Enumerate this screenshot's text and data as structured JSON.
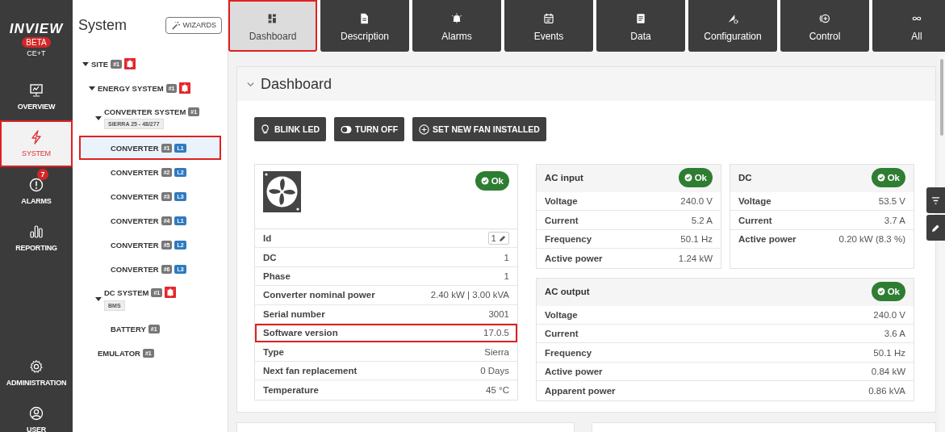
{
  "nav": {
    "logo": "INVIEW",
    "beta": "BETA",
    "subtitle": "CE+T",
    "items": [
      {
        "label": "OVERVIEW",
        "selected": false,
        "highlighted": false
      },
      {
        "label": "SYSTEM",
        "selected": true,
        "highlighted": true
      },
      {
        "label": "ALARMS",
        "selected": false,
        "highlighted": false,
        "badge": "7"
      },
      {
        "label": "REPORTING",
        "selected": false,
        "highlighted": false
      }
    ],
    "bottom_items": [
      {
        "label": "ADMINISTRATION",
        "selected": false,
        "highlighted": false
      },
      {
        "label": "USER",
        "selected": false,
        "highlighted": false
      }
    ]
  },
  "tree": {
    "title": "System",
    "wizards_button": "WIZARDS",
    "nodes": [
      {
        "label": "SITE",
        "tag": "#1",
        "alarm": true,
        "expanded": true,
        "selected": false,
        "highlighted": false,
        "children": [
          {
            "label": "ENERGY SYSTEM",
            "tag": "#1",
            "alarm": true,
            "expanded": true,
            "selected": false,
            "highlighted": false,
            "children": [
              {
                "label": "CONVERTER SYSTEM",
                "tag": "#1",
                "model": "SIERRA 25 - 48/277",
                "alarm": false,
                "expanded": true,
                "selected": false,
                "highlighted": false,
                "children": [
                  {
                    "label": "CONVERTER",
                    "tag": "#1",
                    "phase": "L1",
                    "alarm": false,
                    "selected": true,
                    "highlighted": true
                  },
                  {
                    "label": "CONVERTER",
                    "tag": "#2",
                    "phase": "L2",
                    "alarm": false,
                    "selected": false,
                    "highlighted": false
                  },
                  {
                    "label": "CONVERTER",
                    "tag": "#3",
                    "phase": "L3",
                    "alarm": false,
                    "selected": false,
                    "highlighted": false
                  },
                  {
                    "label": "CONVERTER",
                    "tag": "#4",
                    "phase": "L1",
                    "alarm": false,
                    "selected": false,
                    "highlighted": false
                  },
                  {
                    "label": "CONVERTER",
                    "tag": "#5",
                    "phase": "L2",
                    "alarm": false,
                    "selected": false,
                    "highlighted": false
                  },
                  {
                    "label": "CONVERTER",
                    "tag": "#6",
                    "phase": "L3",
                    "alarm": false,
                    "selected": false,
                    "highlighted": false
                  }
                ]
              },
              {
                "label": "DC SYSTEM",
                "tag": "#1",
                "model": "BMS",
                "alarm": true,
                "expanded": true,
                "selected": false,
                "highlighted": false,
                "children": [
                  {
                    "label": "BATTERY",
                    "tag": "#1",
                    "alarm": false,
                    "selected": false,
                    "highlighted": false
                  }
                ]
              }
            ]
          },
          {
            "label": "EMULATOR",
            "tag": "#1",
            "alarm": false,
            "selected": false,
            "highlighted": false
          }
        ]
      }
    ]
  },
  "tabs": [
    {
      "label": "Dashboard",
      "selected": true,
      "highlighted": true
    },
    {
      "label": "Description",
      "selected": false,
      "highlighted": false
    },
    {
      "label": "Alarms",
      "selected": false,
      "highlighted": false
    },
    {
      "label": "Events",
      "selected": false,
      "highlighted": false
    },
    {
      "label": "Data",
      "selected": false,
      "highlighted": false
    },
    {
      "label": "Configuration",
      "selected": false,
      "highlighted": false
    },
    {
      "label": "Control",
      "selected": false,
      "highlighted": false
    },
    {
      "label": "All",
      "selected": false,
      "highlighted": false
    }
  ],
  "dashboard": {
    "title": "Dashboard",
    "expanded": true,
    "actions": [
      "BLINK LED",
      "TURN OFF",
      "SET NEW FAN INSTALLED"
    ],
    "device": {
      "status": "Ok",
      "rows": [
        {
          "label": "Id",
          "value": "1",
          "editable": true,
          "highlighted": false
        },
        {
          "label": "DC",
          "value": "1",
          "editable": false,
          "highlighted": false
        },
        {
          "label": "Phase",
          "value": "1",
          "editable": false,
          "highlighted": false
        },
        {
          "label": "Converter nominal power",
          "value": "2.40 kW | 3.00 kVA",
          "editable": false,
          "highlighted": false
        },
        {
          "label": "Serial number",
          "value": "3001",
          "editable": false,
          "highlighted": false
        },
        {
          "label": "Software version",
          "value": "17.0.5",
          "editable": false,
          "highlighted": true
        },
        {
          "label": "Type",
          "value": "Sierra",
          "editable": false,
          "highlighted": false
        },
        {
          "label": "Next fan replacement",
          "value": "0 Days",
          "editable": false,
          "highlighted": false
        },
        {
          "label": "Temperature",
          "value": "45 °C",
          "editable": false,
          "highlighted": false
        }
      ]
    },
    "panels": [
      {
        "title": "AC input",
        "status": "Ok",
        "rows": [
          {
            "label": "Voltage",
            "value": "240.0 V"
          },
          {
            "label": "Current",
            "value": "5.2 A"
          },
          {
            "label": "Frequency",
            "value": "50.1 Hz"
          },
          {
            "label": "Active power",
            "value": "1.24 kW"
          }
        ]
      },
      {
        "title": "DC",
        "status": "Ok",
        "rows": [
          {
            "label": "Voltage",
            "value": "53.5 V"
          },
          {
            "label": "Current",
            "value": "3.7 A"
          },
          {
            "label": "Active power",
            "value": "0.20 kW (8.3 %)"
          }
        ]
      },
      {
        "title": "AC output",
        "status": "Ok",
        "rows": [
          {
            "label": "Voltage",
            "value": "240.0 V"
          },
          {
            "label": "Current",
            "value": "3.6 A"
          },
          {
            "label": "Frequency",
            "value": "50.1 Hz"
          },
          {
            "label": "Active power",
            "value": "0.84 kW"
          },
          {
            "label": "Apparent power",
            "value": "0.86 kVA"
          }
        ]
      }
    ]
  }
}
